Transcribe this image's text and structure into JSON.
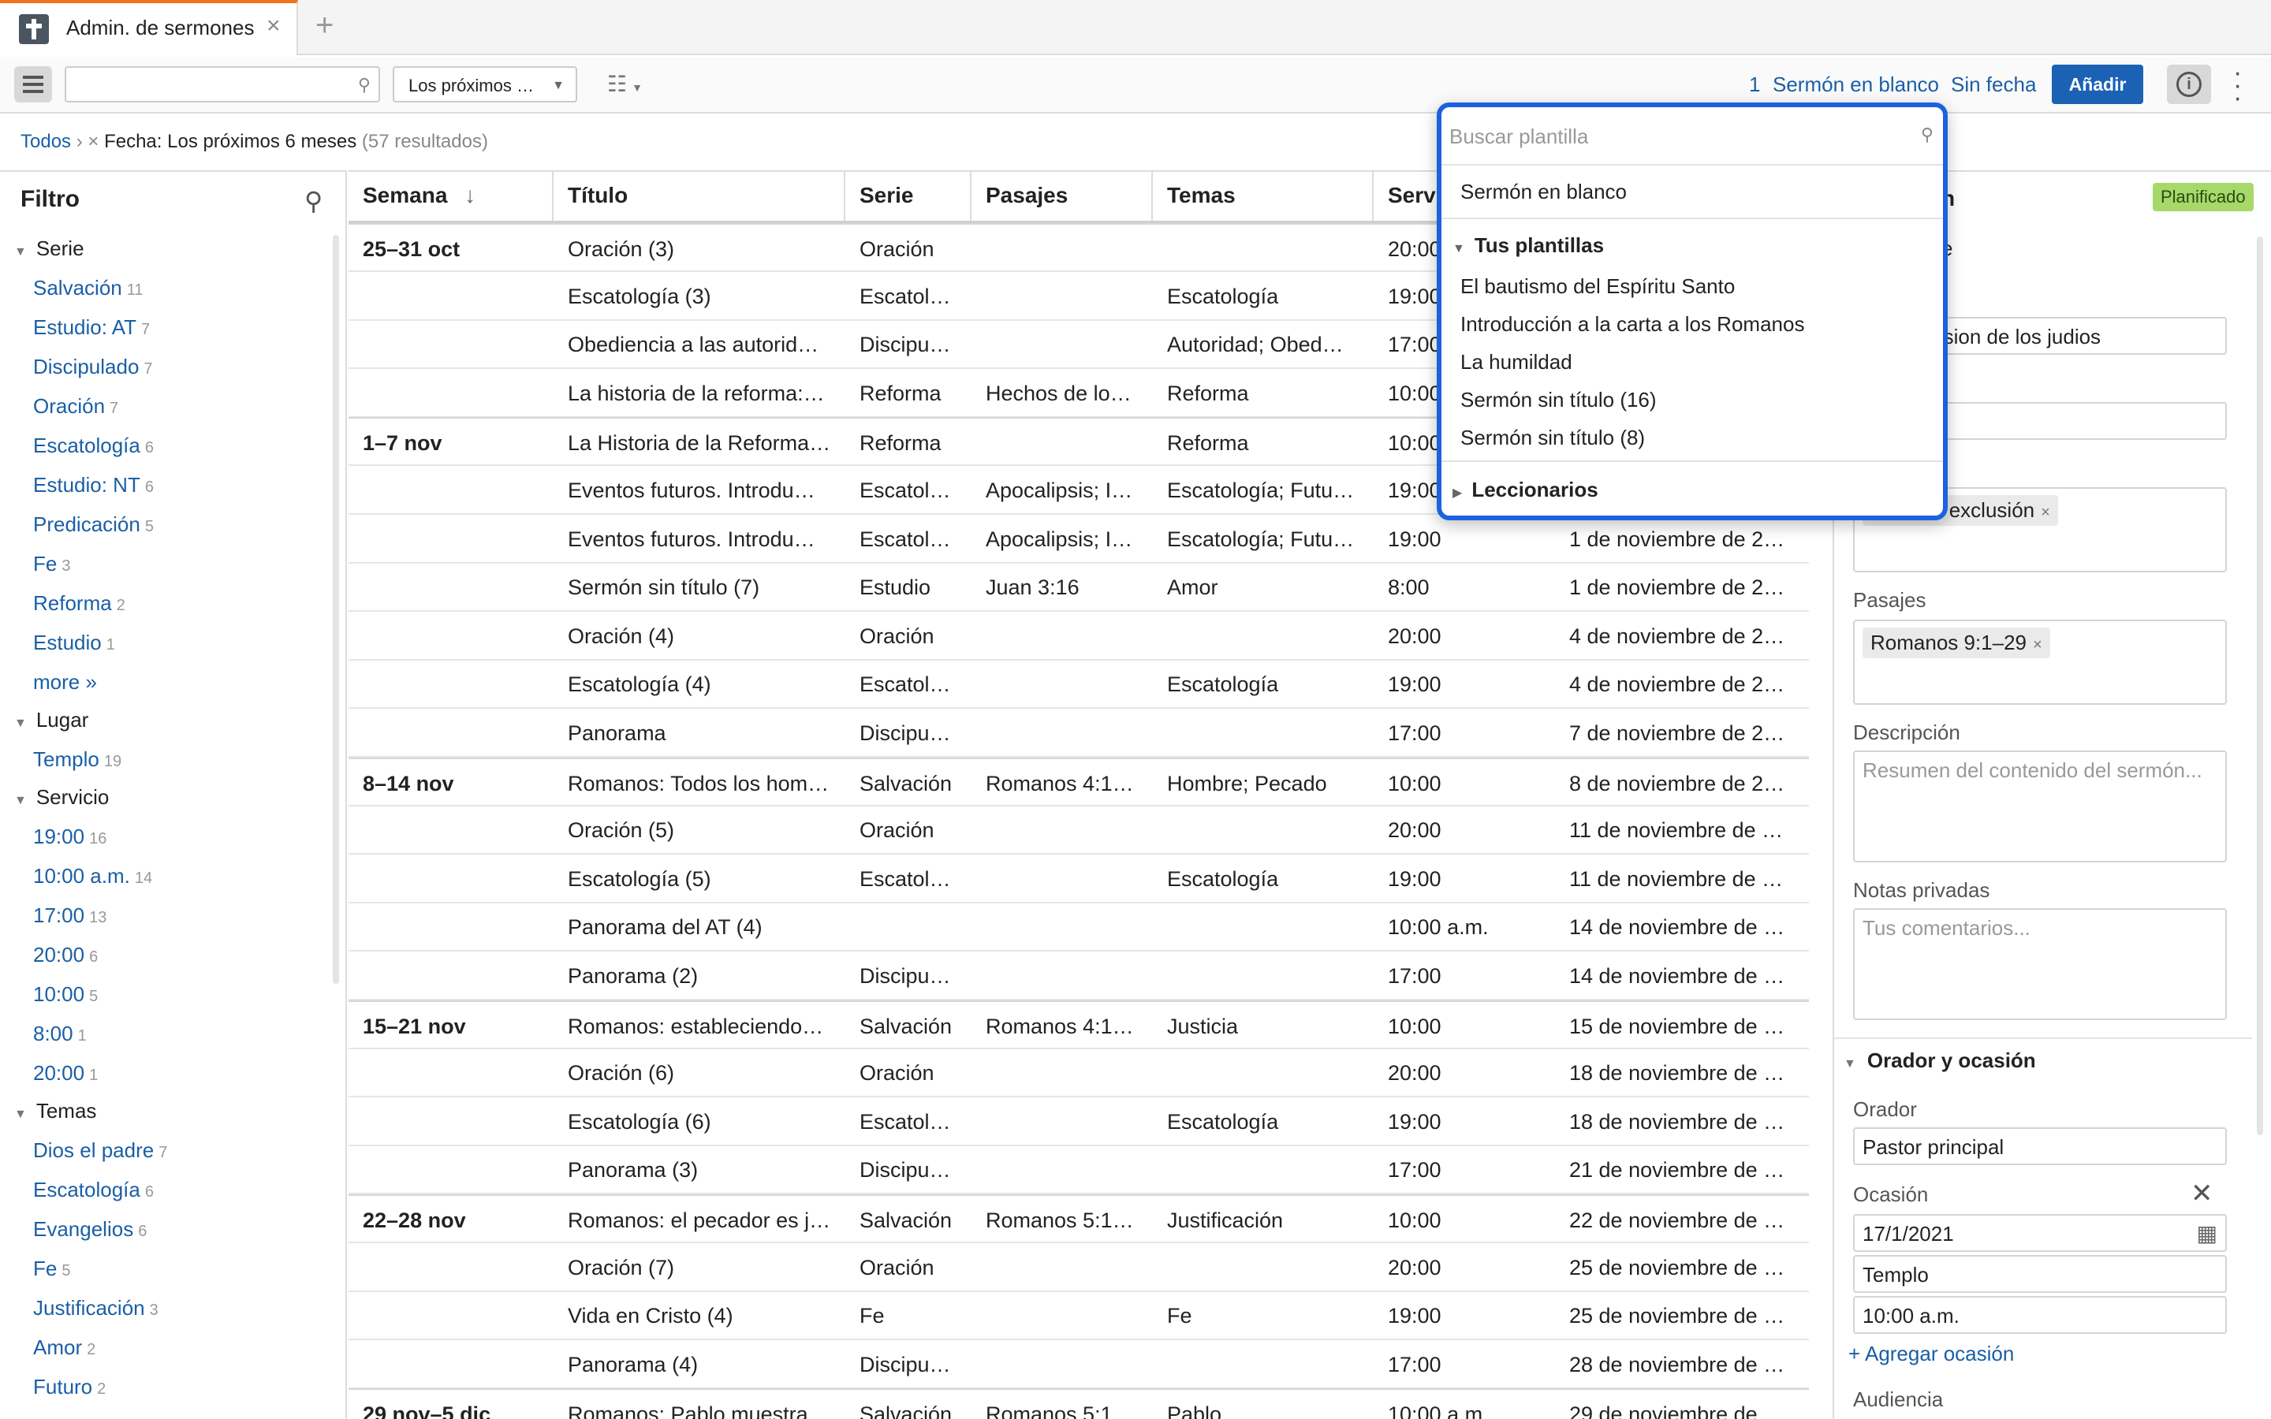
{
  "tab": {
    "title": "Admin. de sermones",
    "close": "×",
    "new": "+"
  },
  "toolbar": {
    "search_placeholder": "",
    "date_filter": "Los próximos …",
    "count": "1",
    "blank_sermon": "Sermón en blanco",
    "no_date": "Sin fecha",
    "add": "Añadir"
  },
  "breadcrumb": {
    "all": "Todos",
    "sep": "›",
    "remove": "×",
    "filter": "Fecha: Los próximos 6 meses",
    "results": "(57 resultados)"
  },
  "filter_panel": {
    "title": "Filtro",
    "sections": [
      {
        "name": "Serie",
        "items": [
          {
            "label": "Salvación",
            "count": "11"
          },
          {
            "label": "Estudio: AT",
            "count": "7"
          },
          {
            "label": "Discipulado",
            "count": "7"
          },
          {
            "label": "Oración",
            "count": "7"
          },
          {
            "label": "Escatología",
            "count": "6"
          },
          {
            "label": "Estudio: NT",
            "count": "6"
          },
          {
            "label": "Predicación",
            "count": "5"
          },
          {
            "label": "Fe",
            "count": "3"
          },
          {
            "label": "Reforma",
            "count": "2"
          },
          {
            "label": "Estudio",
            "count": "1"
          },
          {
            "label": "more »",
            "count": ""
          }
        ]
      },
      {
        "name": "Lugar",
        "items": [
          {
            "label": "Templo",
            "count": "19"
          }
        ]
      },
      {
        "name": "Servicio",
        "items": [
          {
            "label": "19:00",
            "count": "16"
          },
          {
            "label": "10:00 a.m.",
            "count": "14"
          },
          {
            "label": "17:00",
            "count": "13"
          },
          {
            "label": "20:00",
            "count": "6"
          },
          {
            "label": "10:00",
            "count": "5"
          },
          {
            "label": "8:00",
            "count": "1"
          },
          {
            "label": "20:00",
            "count": "1"
          }
        ]
      },
      {
        "name": "Temas",
        "items": [
          {
            "label": "Dios el padre",
            "count": "7"
          },
          {
            "label": "Escatología",
            "count": "6"
          },
          {
            "label": "Evangelios",
            "count": "6"
          },
          {
            "label": "Fe",
            "count": "5"
          },
          {
            "label": "Justificación",
            "count": "3"
          },
          {
            "label": "Amor",
            "count": "2"
          },
          {
            "label": "Futuro",
            "count": "2"
          }
        ]
      }
    ]
  },
  "table": {
    "columns": [
      "Semana",
      "Título",
      "Serie",
      "Pasajes",
      "Temas",
      "Serv",
      ""
    ],
    "rows": [
      [
        "25–31 oct",
        "Oración (3)",
        "Oración",
        "",
        "",
        "20:00",
        ""
      ],
      [
        "",
        "Escatología (3)",
        "Escatol…",
        "",
        "Escatología",
        "19:00",
        ""
      ],
      [
        "",
        "Obediencia a las autorid…",
        "Discipu…",
        "",
        "Autoridad; Obed…",
        "17:00",
        ""
      ],
      [
        "",
        "La historia de la reforma:…",
        "Reforma",
        "Hechos de los…",
        "Reforma",
        "10:00",
        ""
      ],
      [
        "1–7 nov",
        "La Historia de la Reforma…",
        "Reforma",
        "",
        "Reforma",
        "10:00",
        ""
      ],
      [
        "",
        "Eventos futuros. Introdu…",
        "Escatol…",
        "Apocalipsis; I…",
        "Escatología; Futu…",
        "19:00",
        ""
      ],
      [
        "",
        "Eventos futuros. Introdu…",
        "Escatol…",
        "Apocalipsis; I…",
        "Escatología; Futu…",
        "19:00",
        "1 de noviembre de 2…"
      ],
      [
        "",
        "Sermón sin título (7)",
        "Estudio",
        "Juan 3:16",
        "Amor",
        "8:00",
        "1 de noviembre de 2…"
      ],
      [
        "",
        "Oración (4)",
        "Oración",
        "",
        "",
        "20:00",
        "4 de noviembre de 2…"
      ],
      [
        "",
        "Escatología (4)",
        "Escatol…",
        "",
        "Escatología",
        "19:00",
        "4 de noviembre de 2…"
      ],
      [
        "",
        "Panorama",
        "Discipu…",
        "",
        "",
        "17:00",
        "7 de noviembre de 2…"
      ],
      [
        "8–14 nov",
        "Romanos: Todos los hom…",
        "Salvación",
        "Romanos 4:1…",
        "Hombre; Pecado",
        "10:00",
        "8 de noviembre de 2…"
      ],
      [
        "",
        "Oración (5)",
        "Oración",
        "",
        "",
        "20:00",
        "11 de noviembre de …"
      ],
      [
        "",
        "Escatología (5)",
        "Escatol…",
        "",
        "Escatología",
        "19:00",
        "11 de noviembre de …"
      ],
      [
        "",
        "Panorama del AT (4)",
        "",
        "",
        "",
        "10:00 a.m.",
        "14 de noviembre de …"
      ],
      [
        "",
        "Panorama (2)",
        "Discipu…",
        "",
        "",
        "17:00",
        "14 de noviembre de …"
      ],
      [
        "15–21 nov",
        "Romanos: estableciendo…",
        "Salvación",
        "Romanos 4:1…",
        "Justicia",
        "10:00",
        "15 de noviembre de …"
      ],
      [
        "",
        "Oración (6)",
        "Oración",
        "",
        "",
        "20:00",
        "18 de noviembre de …"
      ],
      [
        "",
        "Escatología (6)",
        "Escatol…",
        "",
        "Escatología",
        "19:00",
        "18 de noviembre de …"
      ],
      [
        "",
        "Panorama (3)",
        "Discipu…",
        "",
        "",
        "17:00",
        "21 de noviembre de …"
      ],
      [
        "22–28 nov",
        "Romanos: el pecador es j…",
        "Salvación",
        "Romanos 5:1…",
        "Justificación",
        "10:00",
        "22 de noviembre de …"
      ],
      [
        "",
        "Oración (7)",
        "Oración",
        "",
        "",
        "20:00",
        "25 de noviembre de …"
      ],
      [
        "",
        "Vida en Cristo (4)",
        "Fe",
        "",
        "Fe",
        "19:00",
        "25 de noviembre de …"
      ],
      [
        "",
        "Panorama (4)",
        "Discipu…",
        "",
        "",
        "17:00",
        "28 de noviembre de …"
      ],
      [
        "29 nov–5 dic",
        "Romanos: Pablo muestra…",
        "Salvación",
        "Romanos 5:1…",
        "Pablo",
        "10:00 a.m.",
        "29 de noviembre de …"
      ]
    ]
  },
  "detail": {
    "status": "Planificado",
    "header_partial": "n",
    "field_partial": "e",
    "title_value": ": la exclusion de los judios",
    "topic_chip": "ersia de exclusión",
    "passages_label": "Pasajes",
    "passage_chip": "Romanos 9:1–29",
    "description_label": "Descripción",
    "description_placeholder": "Resumen del contenido del sermón...",
    "notes_label": "Notas privadas",
    "notes_placeholder": "Tus comentarios...",
    "speaker_section": "Orador y ocasión",
    "speaker_label": "Orador",
    "speaker_value": "Pastor principal",
    "occasion_label": "Ocasión",
    "occasion_date": "17/1/2021",
    "occasion_place": "Templo",
    "occasion_time": "10:00 a.m.",
    "add_occasion": "+ Agregar ocasión",
    "audience_label": "Audiencia"
  },
  "template_dropdown": {
    "search_placeholder": "Buscar plantilla",
    "blank": "Sermón en blanco",
    "your_templates": "Tus plantillas",
    "templates": [
      "El bautismo del Espíritu Santo",
      "Introducción a la carta a los Romanos",
      "La humildad",
      "Sermón sin título (16)",
      "Sermón sin título (8)"
    ],
    "lectionaries": "Leccionarios"
  },
  "colors": {
    "accent": "#1b62b5",
    "link": "#1a5fa5",
    "status": "#a6d96a",
    "tab_accent": "#f2711c"
  }
}
